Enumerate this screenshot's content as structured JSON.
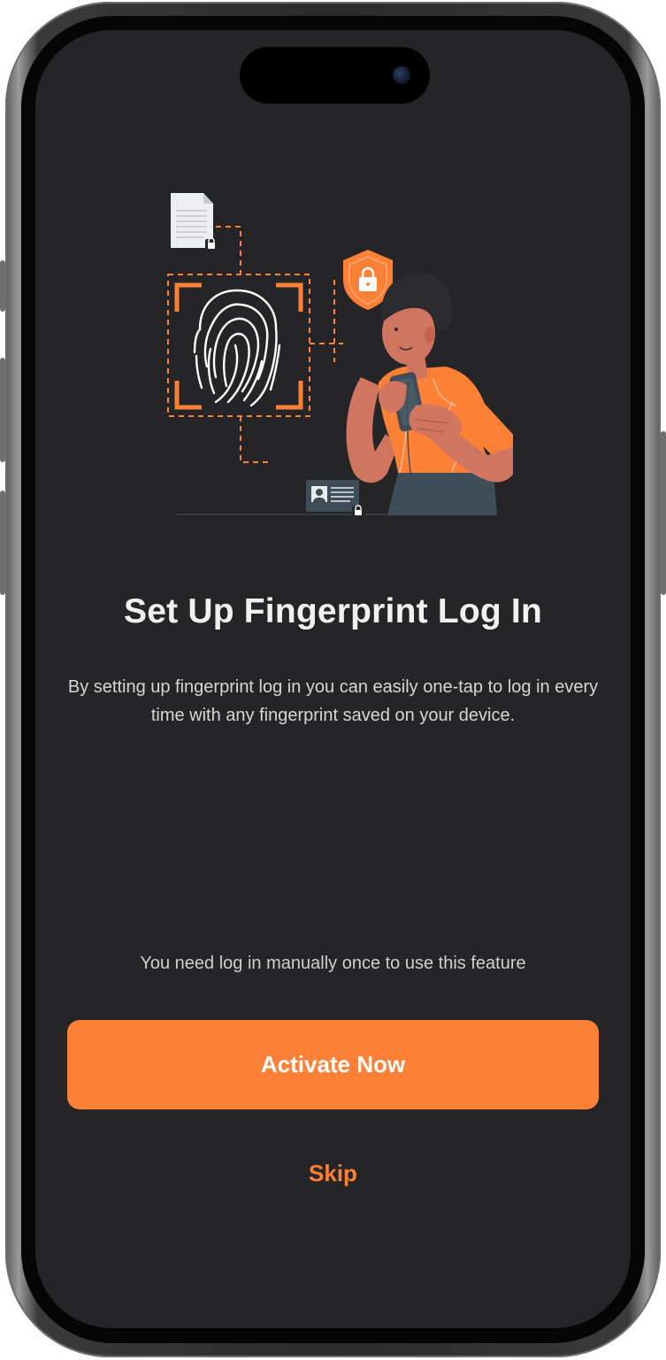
{
  "screen": {
    "title": "Set Up Fingerprint Log In",
    "description": "By setting up fingerprint log in you can easily one-tap to log in every time with any fingerprint saved on your device.",
    "note": "You need log in manually once to use this feature",
    "primary_button_label": "Activate Now",
    "skip_label": "Skip"
  },
  "illustration": {
    "icons": [
      "document-icon",
      "shield-lock-icon",
      "fingerprint-icon",
      "id-card-icon",
      "person-holding-phone"
    ]
  },
  "colors": {
    "accent": "#fd8037",
    "background": "#252527",
    "title_text": "#f1f1f1",
    "body_text": "#d6d6d6"
  }
}
